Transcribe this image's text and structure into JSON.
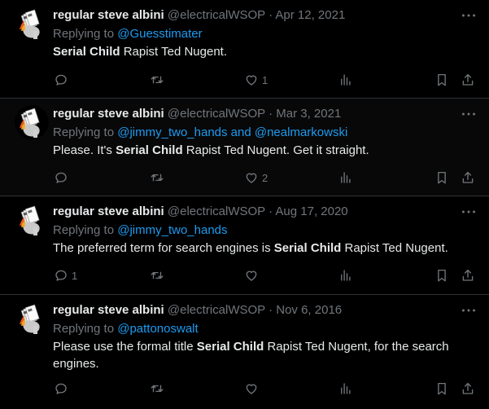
{
  "tweets": [
    {
      "name": "regular steve albini",
      "handle": "@electricalWSOP",
      "separator": "·",
      "date": "Apr 12, 2021",
      "replying_prefix": "Replying to ",
      "replying_to": "@Guesstimater",
      "body_before": "",
      "body_bold": "Serial Child",
      "body_after": " Rapist Ted Nugent.",
      "counts": {
        "replies": "",
        "retweets": "",
        "likes": "1",
        "views": ""
      }
    },
    {
      "name": "regular steve albini",
      "handle": "@electricalWSOP",
      "separator": "·",
      "date": "Mar 3, 2021",
      "replying_prefix": "Replying to ",
      "replying_to": "@jimmy_two_hands and @nealmarkowski",
      "body_before": "Please. It's ",
      "body_bold": "Serial Child",
      "body_after": " Rapist Ted Nugent. Get it straight.",
      "counts": {
        "replies": "",
        "retweets": "",
        "likes": "2",
        "views": ""
      }
    },
    {
      "name": "regular steve albini",
      "handle": "@electricalWSOP",
      "separator": "·",
      "date": "Aug 17, 2020",
      "replying_prefix": "Replying to ",
      "replying_to": "@jimmy_two_hands",
      "body_before": "The preferred term for search engines is ",
      "body_bold": "Serial Child",
      "body_after": " Rapist Ted Nugent.",
      "counts": {
        "replies": "1",
        "retweets": "",
        "likes": "",
        "views": ""
      }
    },
    {
      "name": "regular steve albini",
      "handle": "@electricalWSOP",
      "separator": "·",
      "date": "Nov 6, 2016",
      "replying_prefix": "Replying to ",
      "replying_to": "@pattonoswalt",
      "body_before": "Please use the formal title ",
      "body_bold": "Serial Child",
      "body_after": " Rapist Ted Nugent, for the search engines.",
      "counts": {
        "replies": "",
        "retweets": "",
        "likes": "",
        "views": ""
      }
    }
  ],
  "icons": {
    "avatar": "hand-cards-avatar",
    "more": "more-horizontal-icon",
    "reply": "reply-bubble-icon",
    "retweet": "retweet-icon",
    "like": "heart-icon",
    "views": "bar-chart-icon",
    "bookmark": "bookmark-icon",
    "share": "share-icon"
  },
  "colors": {
    "background": "#000000",
    "text": "#e7e9ea",
    "muted": "#71767b",
    "link": "#1d9bf0",
    "divider": "#2f3336"
  }
}
